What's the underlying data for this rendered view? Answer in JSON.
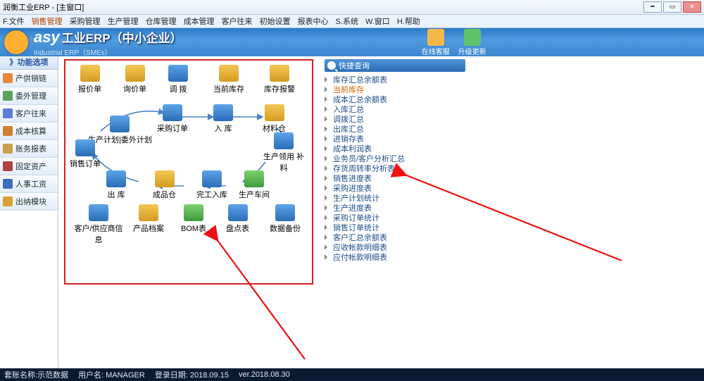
{
  "window": {
    "title": "润衡工业ERP - [主窗口]"
  },
  "menu": [
    "F.文件",
    "销售管理",
    "采购管理",
    "生产管理",
    "仓库管理",
    "成本管理",
    "客户往来",
    "初始设置",
    "报表中心",
    "S.系统",
    "W.窗口",
    "H.帮助"
  ],
  "menu_active_index": 1,
  "banner": {
    "title_cn": "工业ERP（中小企业）",
    "title_easy": "asy",
    "title_en": "Industrial ERP（SMEs）",
    "btn_support": "在线客服",
    "btn_update": "升级更新"
  },
  "leftnav": {
    "header": "》功能选项",
    "items": [
      "产供销链",
      "委外管理",
      "客户往来",
      "成本核算",
      "账务报表",
      "固定资产",
      "人事工资",
      "出纳模块"
    ]
  },
  "diagram": {
    "top_row": [
      "报价单",
      "询价单",
      "调  拨",
      "当前库存",
      "库存报警"
    ],
    "mid": {
      "prod_plan": "生产计划",
      "outsource": "委外计划",
      "purchase_order": "采购订单",
      "stock_in": "入  库",
      "material": "材料仓",
      "sales_order": "销售订单",
      "issue": "生产领用  补料",
      "stock_out": "出  库",
      "finished": "成品仓",
      "complete_in": "完工入库",
      "workshop": "生产车间"
    },
    "bottom_row": [
      "客户/供应商信息",
      "产品档案",
      "BOM表",
      "盘点表",
      "数据备份"
    ]
  },
  "quicksearch": {
    "header": "快捷查询",
    "items": [
      "库存汇总余额表",
      "当前库存",
      "成本汇总余额表",
      "入库汇总",
      "调拨汇总",
      "出库汇总",
      "进销存表",
      "成本利润表",
      "业务员/客户分析汇总",
      "存货周转率分析表",
      "销售进度表",
      "采购进度表",
      "生产计划统计",
      "生产进度表",
      "采购订单统计",
      "销售订单统计",
      "客户汇总余额表",
      "应收帐款明细表",
      "应付帐款明细表"
    ],
    "hot_index": 1
  },
  "status": {
    "db": "套账名称:示范数据",
    "user": "用户名: MANAGER",
    "login": "登录日期: 2018.09.15",
    "ver": "ver.2018.08.30"
  }
}
